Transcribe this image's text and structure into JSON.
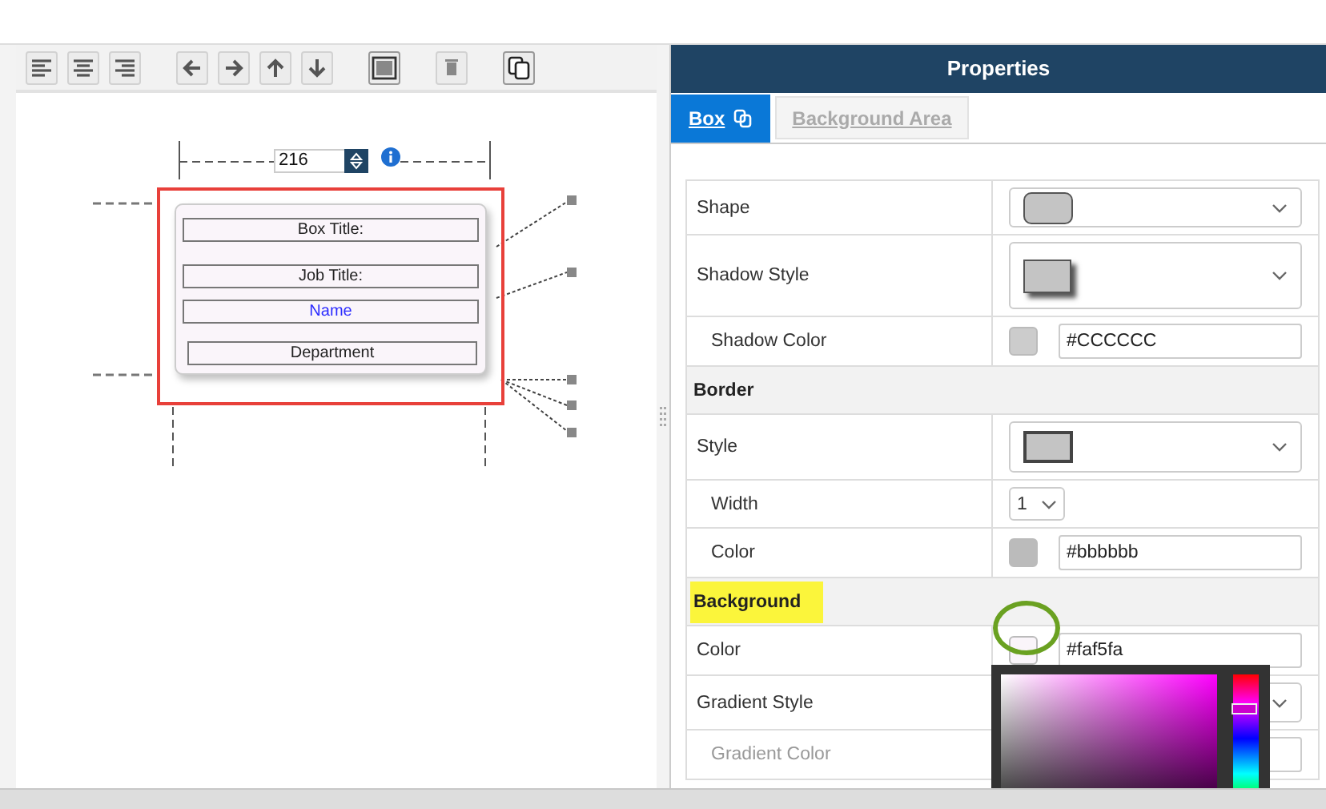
{
  "toolbar": {
    "groups": [
      [
        {
          "kind": "align-left"
        },
        {
          "kind": "align-center"
        },
        {
          "kind": "align-right"
        }
      ],
      [
        {
          "kind": "arrow-left"
        },
        {
          "kind": "arrow-right"
        },
        {
          "kind": "arrow-up"
        },
        {
          "kind": "arrow-down"
        }
      ],
      [
        {
          "kind": "fit"
        }
      ],
      [
        {
          "kind": "trash"
        }
      ],
      [
        {
          "kind": "copy"
        }
      ]
    ]
  },
  "canvas": {
    "width_value": "216",
    "card": {
      "selected": true,
      "fields": [
        {
          "text": "Box Title:",
          "kind": "label"
        },
        {
          "text": "Job Title:",
          "kind": "label"
        },
        {
          "text": "Name",
          "kind": "name"
        },
        {
          "text": "Department",
          "kind": "label"
        }
      ]
    }
  },
  "properties": {
    "title": "Properties",
    "tabs": [
      {
        "label": "Box",
        "selected": true,
        "has_icon": true
      },
      {
        "label": "Background Area",
        "selected": false,
        "has_icon": false
      }
    ],
    "rows": [
      {
        "label": "Shape",
        "kind": "shape-select",
        "indented": false
      },
      {
        "label": "Shadow Style",
        "kind": "shadow-select",
        "indented": false
      },
      {
        "label": "Shadow Color",
        "kind": "color",
        "value": "#CCCCCC",
        "indented": true
      },
      {
        "label": "Border",
        "kind": "header",
        "highlighted": false
      },
      {
        "label": "Style",
        "kind": "border-select",
        "indented": false
      },
      {
        "label": "Width",
        "kind": "number",
        "value": "1",
        "indented": true
      },
      {
        "label": "Color",
        "kind": "color",
        "value": "#bbbbbb",
        "indented": true
      },
      {
        "label": "Background",
        "kind": "header",
        "highlighted": true
      },
      {
        "label": "Color",
        "kind": "color",
        "value": "#faf5fa",
        "indented": false,
        "picker_open": true,
        "circled": true
      },
      {
        "label": "Gradient Style",
        "kind": "select",
        "indented": false
      },
      {
        "label": "Gradient Color",
        "kind": "color",
        "indented": true,
        "disabled": true
      }
    ]
  }
}
